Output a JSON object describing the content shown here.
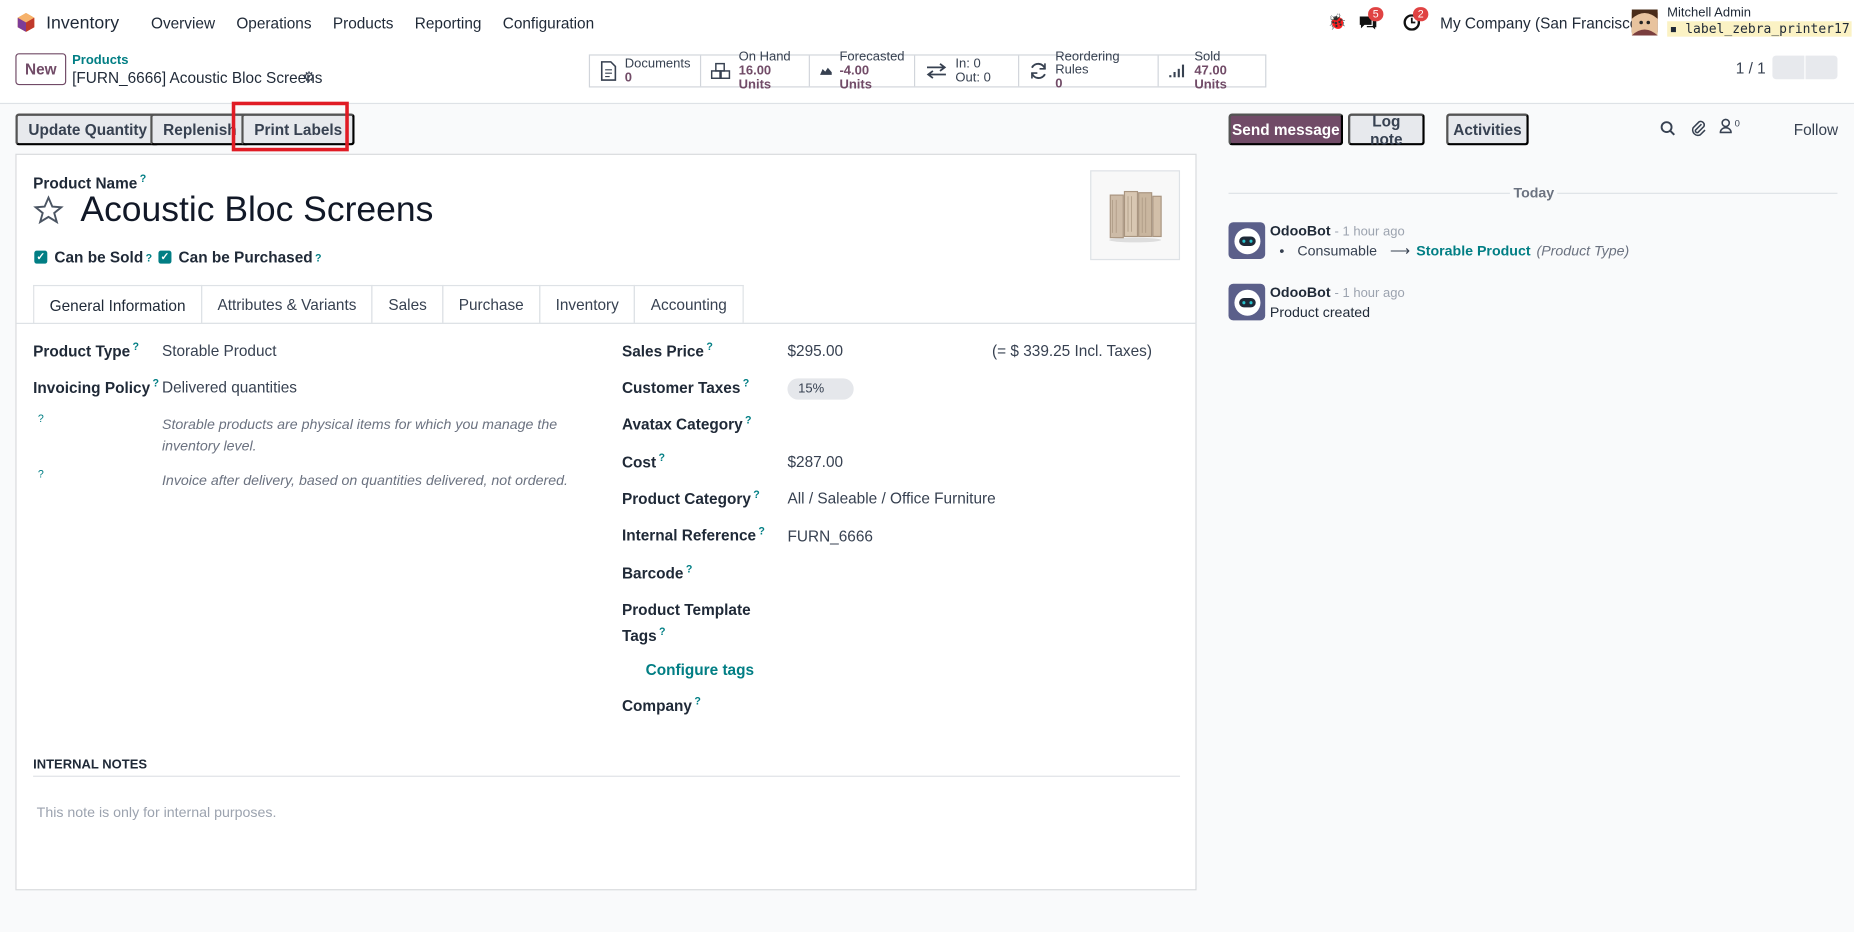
{
  "nav": {
    "app_name": "Inventory",
    "menu": [
      "Overview",
      "Operations",
      "Products",
      "Reporting",
      "Configuration"
    ],
    "messages_count": "5",
    "activities_count": "2",
    "company": "My Company (San Francisco)",
    "user_name": "Mitchell Admin",
    "db_name": "label_zebra_printer17"
  },
  "control": {
    "new_label": "New",
    "breadcrumb_parent": "Products",
    "breadcrumb_current": "[FURN_6666] Acoustic Bloc Screens",
    "pager": "1 / 1",
    "stats": [
      {
        "title": "Documents",
        "value": "0"
      },
      {
        "title": "On Hand",
        "value": "16.00 Units"
      },
      {
        "title": "Forecasted",
        "value": "-4.00 Units"
      },
      {
        "title": "In: 0",
        "value": "Out: 0"
      },
      {
        "title": "Reordering Rules",
        "value": "0"
      },
      {
        "title": "Sold",
        "value": "47.00 Units"
      }
    ]
  },
  "actions": {
    "update_qty": "Update Quantity",
    "replenish": "Replenish",
    "print_labels": "Print Labels"
  },
  "form": {
    "product_name_label": "Product Name",
    "product_name": "Acoustic Bloc Screens",
    "can_be_sold": "Can be Sold",
    "can_be_purchased": "Can be Purchased",
    "tabs": [
      "General Information",
      "Attributes & Variants",
      "Sales",
      "Purchase",
      "Inventory",
      "Accounting"
    ],
    "left": {
      "product_type_label": "Product Type",
      "product_type": "Storable Product",
      "invoicing_policy_label": "Invoicing Policy",
      "invoicing_policy": "Delivered quantities",
      "help1": "Storable products are physical items for which you manage the inventory level.",
      "help2": "Invoice after delivery, based on quantities delivered, not ordered."
    },
    "right": {
      "sales_price_label": "Sales Price",
      "sales_price": "$295.00",
      "incl_taxes": "(= $ 339.25 Incl. Taxes)",
      "customer_taxes_label": "Customer Taxes",
      "customer_taxes": "15%",
      "avatax_label": "Avatax Category",
      "cost_label": "Cost",
      "cost": "$287.00",
      "category_label": "Product Category",
      "category": "All / Saleable / Office Furniture",
      "internal_ref_label": "Internal Reference",
      "internal_ref": "FURN_6666",
      "barcode_label": "Barcode",
      "tags_label_1": "Product Template",
      "tags_label_2": "Tags",
      "configure_tags": "Configure tags",
      "company_label": "Company"
    },
    "internal_notes_title": "INTERNAL NOTES",
    "internal_notes_placeholder": "This note is only for internal purposes."
  },
  "chatter": {
    "send_message": "Send message",
    "log_note": "Log note",
    "activities": "Activities",
    "followers_count": "0",
    "follow": "Follow",
    "today": "Today",
    "messages": [
      {
        "author": "OdooBot",
        "time": "- 1 hour ago",
        "old": "Consumable",
        "arrow": "⟶",
        "new": "Storable Product",
        "field": "(Product Type)"
      },
      {
        "author": "OdooBot",
        "time": "- 1 hour ago",
        "body": "Product created"
      }
    ]
  },
  "colors": {
    "brand": "#714b67",
    "link": "#017e84",
    "highlight": "#e01b24"
  }
}
